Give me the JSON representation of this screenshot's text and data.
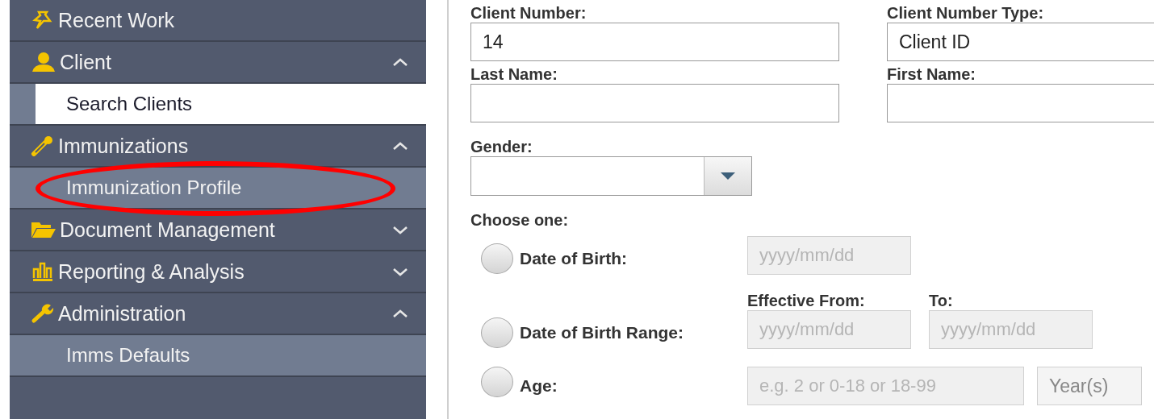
{
  "sidebar": {
    "items": [
      {
        "label": "Recent Work"
      },
      {
        "label": "Client",
        "expanded": true,
        "children": [
          {
            "label": "Search Clients",
            "selected": true,
            "circled": false
          }
        ]
      },
      {
        "label": "Immunizations",
        "expanded": true,
        "children": [
          {
            "label": "Immunization Profile",
            "selected": false,
            "circled": true
          }
        ]
      },
      {
        "label": "Document Management",
        "expanded": false
      },
      {
        "label": "Reporting & Analysis",
        "expanded": false
      },
      {
        "label": "Administration",
        "expanded": true,
        "children": [
          {
            "label": "Imms Defaults",
            "selected": false,
            "circled": false
          }
        ]
      }
    ]
  },
  "form": {
    "client_number": {
      "label": "Client Number:",
      "value": "14"
    },
    "client_number_type": {
      "label": "Client Number Type:",
      "value": "Client ID"
    },
    "last_name": {
      "label": "Last Name:"
    },
    "first_name": {
      "label": "First Name:"
    },
    "gender": {
      "label": "Gender:"
    },
    "choose_label": "Choose one:",
    "options": [
      {
        "kind": "date",
        "label": "Date of Birth:",
        "selected": false,
        "placeholder": "yyyy/mm/dd"
      },
      {
        "kind": "range",
        "label": "Date of Birth Range:",
        "selected": false,
        "from_label": "Effective From:",
        "to_label": "To:",
        "from_placeholder": "yyyy/mm/dd",
        "to_placeholder": "yyyy/mm/dd"
      },
      {
        "kind": "age",
        "label": "Age:",
        "selected": false,
        "placeholder": "e.g. 2 or 0-18 or 18-99",
        "unit": "Year(s)"
      }
    ]
  }
}
